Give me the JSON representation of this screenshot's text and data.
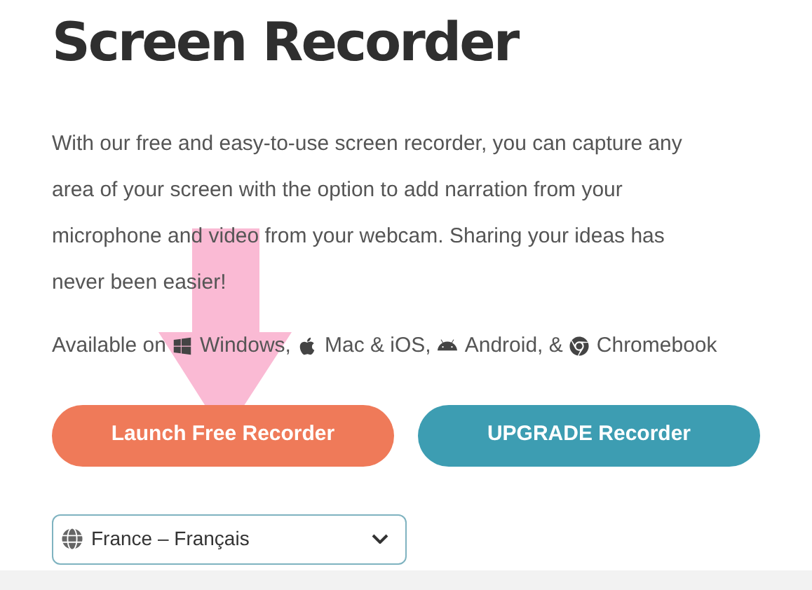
{
  "title": "Screen Recorder",
  "intro": "With our free and easy-to-use screen recorder, you can capture any area of your screen with the option to add narration from your microphone and video from your webcam. Sharing your ideas has never been easier!",
  "availability": {
    "prefix": "Available on",
    "platforms": [
      {
        "kind": "windows",
        "label": "Windows,"
      },
      {
        "kind": "apple",
        "label": "Mac & iOS,"
      },
      {
        "kind": "android",
        "label": "Android, &"
      },
      {
        "kind": "chrome",
        "label": "Chromebook"
      }
    ]
  },
  "buttons": [
    {
      "kind": "primary",
      "label": "Launch Free Recorder"
    },
    {
      "kind": "secondary",
      "label": "UPGRADE Recorder"
    }
  ],
  "language_select": {
    "value": "France – Français"
  }
}
